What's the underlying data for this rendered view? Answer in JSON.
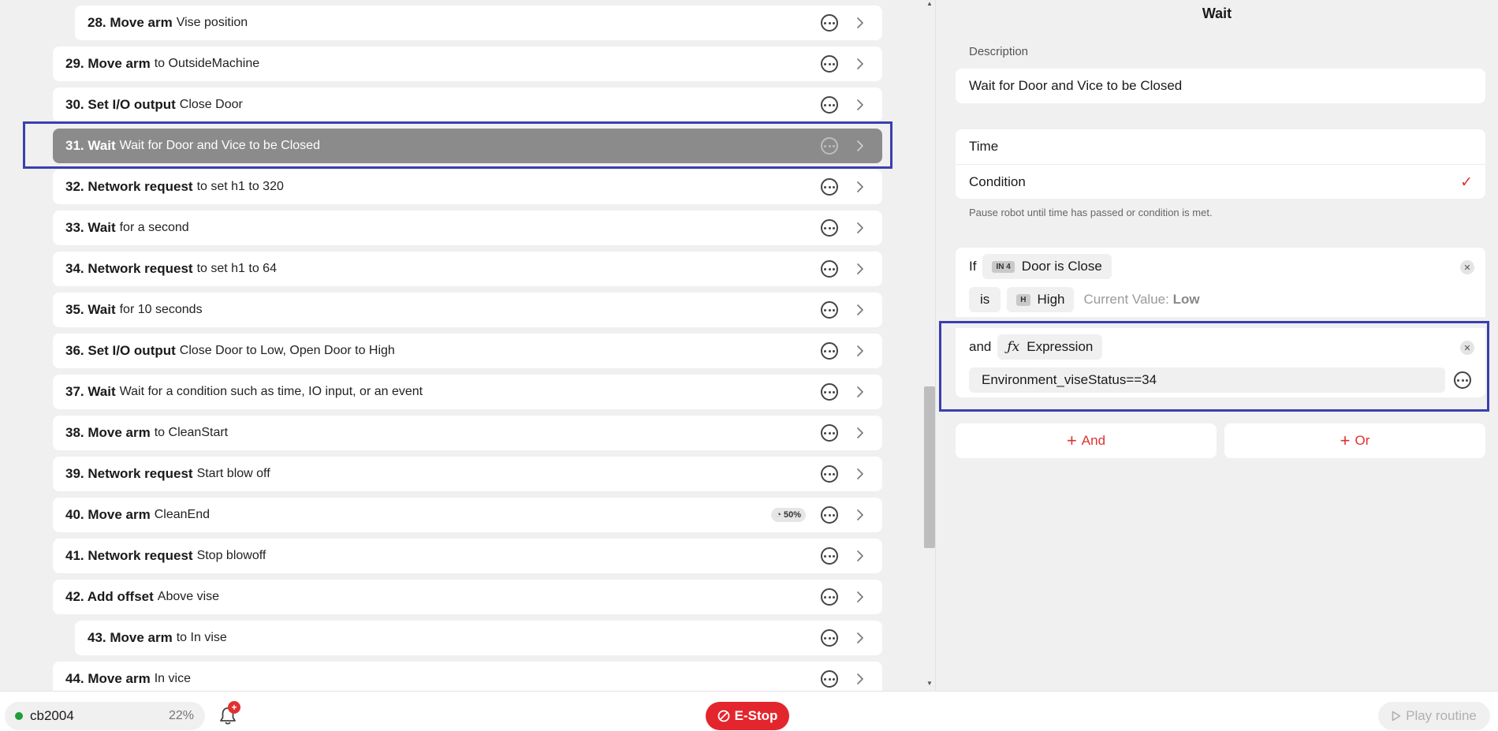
{
  "routine_steps": [
    {
      "num": "28. Move arm",
      "desc": "Vise position",
      "indent": true
    },
    {
      "num": "29. Move arm",
      "desc": "to OutsideMachine",
      "indent": false
    },
    {
      "num": "30. Set I/O output",
      "desc": "Close Door",
      "indent": false
    },
    {
      "num": "31. Wait",
      "desc": "Wait for Door and Vice to be Closed",
      "indent": false,
      "selected": true
    },
    {
      "num": "32. Network request",
      "desc": "to set h1 to 320",
      "indent": false
    },
    {
      "num": "33. Wait",
      "desc": "for a second",
      "indent": false
    },
    {
      "num": "34. Network request",
      "desc": "to set h1 to 64",
      "indent": false
    },
    {
      "num": "35. Wait",
      "desc": "for 10 seconds",
      "indent": false
    },
    {
      "num": "36. Set I/O output",
      "desc": "Close Door to Low, Open Door to High",
      "indent": false
    },
    {
      "num": "37. Wait",
      "desc": "Wait for a condition such as time, IO input, or an event",
      "indent": false
    },
    {
      "num": "38. Move arm",
      "desc": "to CleanStart",
      "indent": false
    },
    {
      "num": "39. Network request",
      "desc": "Start blow off",
      "indent": false
    },
    {
      "num": "40. Move arm",
      "desc": "CleanEnd",
      "indent": false,
      "badge": "50%"
    },
    {
      "num": "41. Network request",
      "desc": "Stop blowoff",
      "indent": false
    },
    {
      "num": "42. Add offset",
      "desc": "Above vise",
      "indent": false
    },
    {
      "num": "43. Move arm",
      "desc": "to In vise",
      "indent": true
    },
    {
      "num": "44. Move arm",
      "desc": "In vice",
      "indent": false
    }
  ],
  "panel": {
    "title": "Wait",
    "description_label": "Description",
    "description_value": "Wait for Door and Vice to be Closed",
    "mode_options": [
      "Time",
      "Condition"
    ],
    "selected_mode": "Condition",
    "mode_hint": "Pause robot until time has passed or condition is met.",
    "condition1": {
      "prefix": "If",
      "io_tag": "IN 4",
      "io_name": "Door is Close",
      "is_label": "is",
      "level_tag": "H",
      "level": "High",
      "current_label": "Current Value:",
      "current_value": "Low"
    },
    "condition2": {
      "prefix": "and",
      "fx_symbol": "ƒx",
      "type": "Expression",
      "expression": "Environment_viseStatus==34"
    },
    "and_button": "And",
    "or_button": "Or"
  },
  "bottombar": {
    "robot_name": "cb2004",
    "robot_percent": "22%",
    "notif_count": "+",
    "estop_label": "E-Stop",
    "play_label": "Play routine"
  },
  "colors": {
    "accent_red": "#e0302f",
    "selection_outline": "#3a3fb0",
    "selected_row": "#8c8b8b",
    "status_green": "#1f9d3a"
  }
}
